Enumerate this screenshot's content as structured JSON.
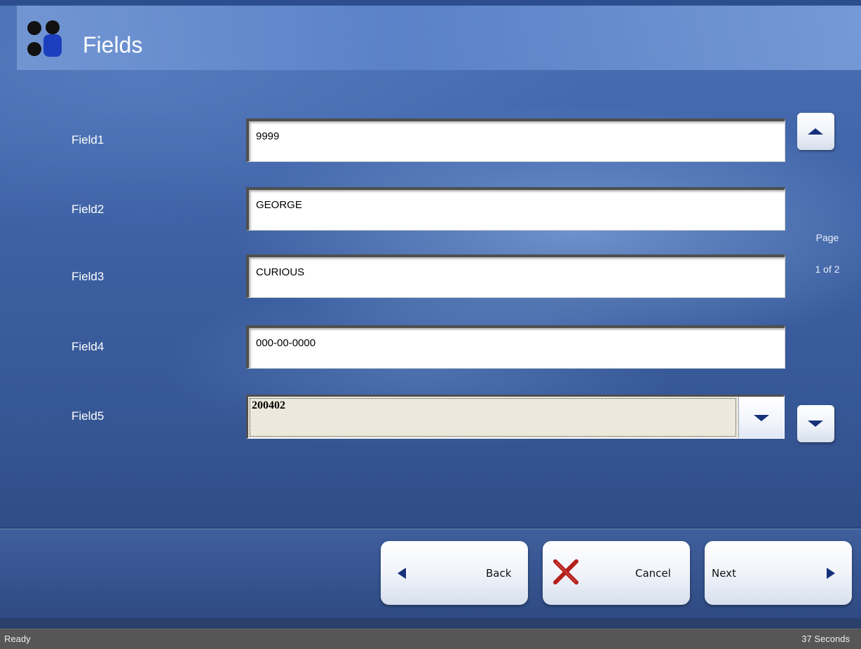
{
  "header": {
    "title": "Fields",
    "logo_icon": "four-dots-logo-icon"
  },
  "fields": [
    {
      "label": "Field1",
      "value": "9999"
    },
    {
      "label": "Field2",
      "value": "GEORGE"
    },
    {
      "label": "Field3",
      "value": "CURIOUS"
    },
    {
      "label": "Field4",
      "value": "000-00-0000"
    },
    {
      "label": "Field5",
      "value": "200402"
    }
  ],
  "pager": {
    "page_label": "Page",
    "page_count": "1 of 2"
  },
  "buttons": {
    "back": "Back",
    "cancel": "Cancel",
    "next": "Next"
  },
  "status": {
    "left": "Ready",
    "right": "37 Seconds"
  },
  "colors": {
    "accent": "#16307a",
    "cancel_x": "#b3201c",
    "background": "#3e62a5"
  }
}
